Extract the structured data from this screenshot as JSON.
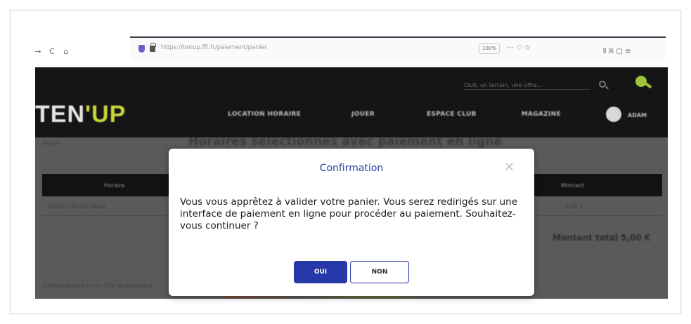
{
  "browser": {
    "nav": {
      "forward_icon": "→",
      "reload_icon": "C",
      "home_icon": "⌂"
    },
    "url": "https://tenup.fft.fr/paiement/panier",
    "zoom": "100%",
    "url_actions": "··· ♡ ☆",
    "toolbar_icons": "⫴ ℝ ▢ ≡"
  },
  "site": {
    "logo_main": "TEN",
    "logo_accent": "'UP",
    "search_placeholder": "Club, un terrain, une offre...",
    "nav": [
      "LOCATION HORAIRE",
      "JOUER",
      "ESPACE CLUB",
      "MAGAZINE"
    ],
    "account_label": "ADAM"
  },
  "page": {
    "breadcrumb": "Panier",
    "title": "Horaires sélectionnés avec paiement en ligne",
    "table": {
      "headers": [
        "Horaire",
        "Montant"
      ],
      "row": [
        "Détail / Terrain Padel",
        "5,00 €"
      ]
    },
    "total": "Montant total 5,00 €",
    "footnote": "Conformément à nos CGV de paiement..."
  },
  "modal": {
    "title": "Confirmation",
    "close_symbol": "✕",
    "message": "Vous vous apprêtez à valider votre panier. Vous serez redirigés sur une interface de paiement en ligne pour procéder au paiement. Souhaitez-vous continuer ?",
    "confirm_label": "OUI",
    "cancel_label": "NON"
  },
  "colors": {
    "modal_title": "#2a3d9e",
    "primary_button": "#2738a8",
    "logo_accent": "#c9d63a",
    "header_bg": "#151515"
  }
}
